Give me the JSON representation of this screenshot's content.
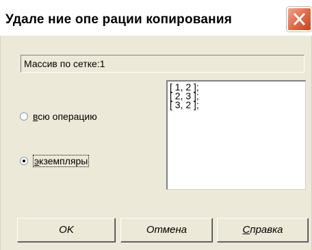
{
  "window": {
    "title": "Удале ние опе рации копирования"
  },
  "header": {
    "text": "Массив по сетке:1"
  },
  "options": {
    "whole_operation_label": "всю операцию",
    "whole_operation_access_key": "в",
    "whole_operation_rest": "сю операцию",
    "instances_label": "экземпляры",
    "instances_access_key": "э",
    "instances_rest": "кземпляры",
    "selected": "instances"
  },
  "instances_list": {
    "items": [
      "[ 1, 2 ];",
      "[ 2, 3 ];",
      "[ 3, 2 ];"
    ]
  },
  "buttons": {
    "ok_label": "OK",
    "cancel_label": "Отмена",
    "help_label": "Справка",
    "help_access_key": "С",
    "help_rest": "правка"
  },
  "colors": {
    "dialog_bg": "#ece9d8",
    "close_button": "#e36b48"
  }
}
